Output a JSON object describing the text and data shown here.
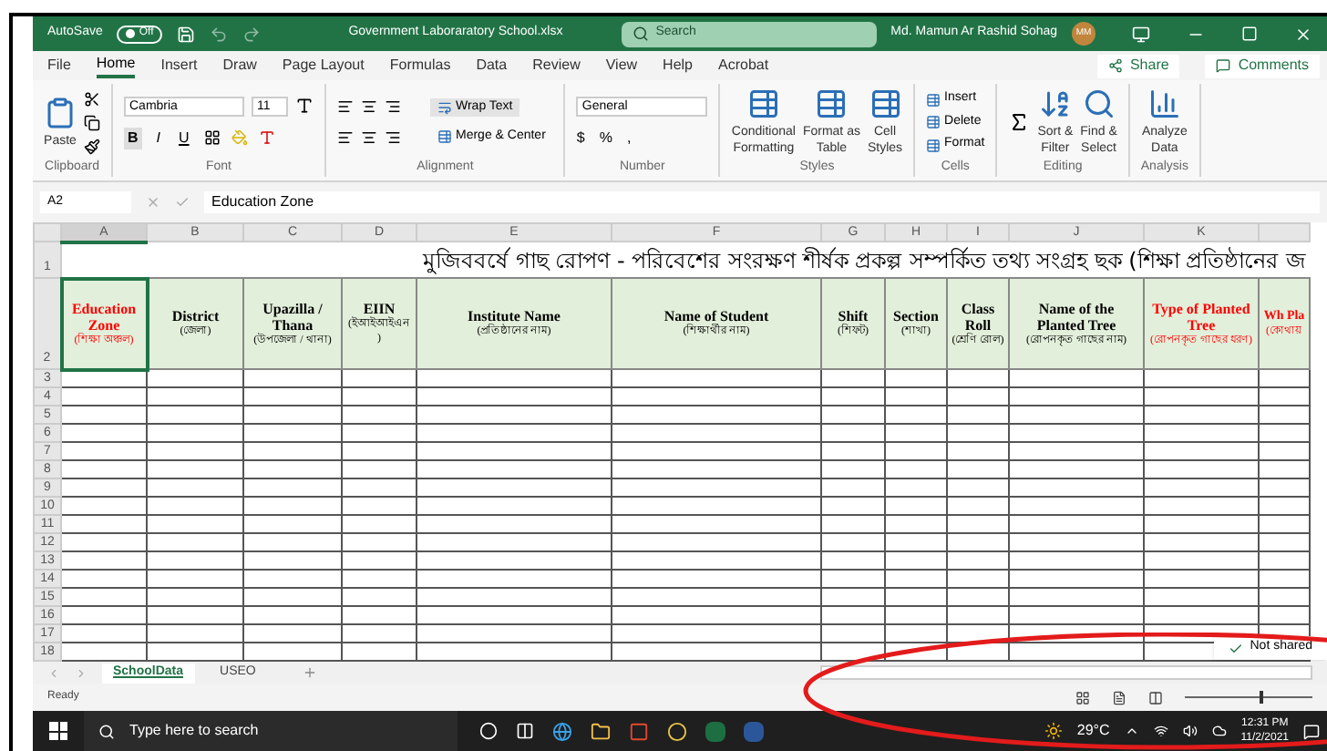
{
  "title_bar": {
    "autosave_label": "AutoSave",
    "autosave": {
      "label": "Off",
      "on": false
    },
    "filename": "Government Laboraratory School.xlsx",
    "search_placeholder": "Search",
    "user": "Md. Mamun Ar Rashid Sohag",
    "avatar": "MM"
  },
  "ribbon_tabs": [
    {
      "label": "File",
      "selected": false
    },
    {
      "label": "Home",
      "selected": true
    },
    {
      "label": "Insert",
      "selected": false
    },
    {
      "label": "Draw",
      "selected": false
    },
    {
      "label": "Page Layout",
      "selected": false
    },
    {
      "label": "Formulas",
      "selected": false
    },
    {
      "label": "Data",
      "selected": false
    },
    {
      "label": "Review",
      "selected": false
    },
    {
      "label": "View",
      "selected": false
    },
    {
      "label": "Help",
      "selected": false
    },
    {
      "label": "Acrobat",
      "selected": false
    }
  ],
  "share": "Share",
  "comments": "Comments",
  "ribbon": {
    "clipboard": {
      "paste": "Paste",
      "label": "Clipboard"
    },
    "font": {
      "name": "Cambria",
      "size": "11",
      "styles": [
        "B",
        "I",
        "U"
      ],
      "label": "Font"
    },
    "alignment": {
      "wrap": "Wrap Text",
      "merge": "Merge & Center",
      "label": "Alignment"
    },
    "number": {
      "format": "General",
      "buttons": [
        "$",
        "%",
        ","
      ],
      "label": "Number"
    },
    "styles": {
      "buttons": [
        [
          "Conditional",
          "Formatting"
        ],
        [
          "Format as",
          "Table"
        ],
        [
          "Cell",
          "Styles"
        ]
      ],
      "label": "Styles"
    },
    "cells": {
      "buttons": [
        "Insert",
        "Delete",
        "Format"
      ],
      "label": "Cells"
    },
    "editing": {
      "buttons": [
        [
          "Sort &",
          "Filter"
        ],
        [
          "Find &",
          "Select"
        ]
      ],
      "label": "Editing"
    },
    "analysis": {
      "button": [
        "Analyze",
        "Data"
      ],
      "label": "Analysis"
    }
  },
  "formula_bar": {
    "name_box": "A2",
    "value": "Education Zone"
  },
  "sheet": {
    "column_letters": [
      "A",
      "B",
      "C",
      "D",
      "E",
      "F",
      "G",
      "H",
      "I",
      "J",
      "K"
    ],
    "title": "মুজিববর্ষে গাছ রোপণ - পরিবেশের সংরক্ষণ শীর্ষক প্রকল্প সম্পর্কিত তথ্য সংগ্রহ ছক (শিক্ষা প্রতিষ্ঠানের জ",
    "headers": [
      {
        "title": "Education Zone",
        "subtitle": "(শিক্ষা অঞ্চল)",
        "color": "#ff0000",
        "selected": true
      },
      {
        "title": "District",
        "subtitle": "(জেলা)",
        "color": "#000000",
        "selected": false
      },
      {
        "title": "Upazilla / Thana",
        "subtitle": "(উপজেলা / থানা)",
        "color": "#000000",
        "selected": false
      },
      {
        "title": "EIIN",
        "subtitle": "(ইআইআইএন )",
        "color": "#000000",
        "selected": false
      },
      {
        "title": "Institute Name",
        "subtitle": "(প্রতিষ্ঠানের নাম)",
        "color": "#000000",
        "selected": false
      },
      {
        "title": "Name of Student",
        "subtitle": "(শিক্ষার্থীর নাম)",
        "color": "#000000",
        "selected": false
      },
      {
        "title": "Shift",
        "subtitle": "(শিফট)",
        "color": "#000000",
        "selected": false
      },
      {
        "title": "Section",
        "subtitle": "(শাখা)",
        "color": "#000000",
        "selected": false
      },
      {
        "title": "Class Roll",
        "subtitle": "(শ্রেণি রোল)",
        "color": "#000000",
        "selected": false
      },
      {
        "title": "Name of the Planted Tree",
        "subtitle": "(রোপনকৃত গাছের নাম)",
        "color": "#000000",
        "selected": false
      },
      {
        "title": "Type of Planted Tree",
        "subtitle": "(রোপনকৃত গাছের ধরণ)",
        "color": "#ff0000",
        "selected": false
      },
      {
        "title": "Wh Pla",
        "subtitle": "(কোথায়",
        "color": "#ff0000",
        "selected": false
      }
    ],
    "row_numbers": [
      "1",
      "2",
      "3",
      "4",
      "5",
      "6",
      "7",
      "8",
      "9",
      "10",
      "11",
      "12",
      "13",
      "14",
      "15",
      "16",
      "17",
      "18"
    ]
  },
  "sheet_tabs": [
    {
      "label": "SchoolData",
      "selected": true
    },
    {
      "label": "USEO",
      "selected": false
    }
  ],
  "toast": "Not shared",
  "status": "Ready",
  "zoom": {
    "level": 0.6
  },
  "taskbar": {
    "search_placeholder": "Type here to search",
    "temperature": "29°C",
    "time": "12:31 PM",
    "date": "11/2/2021"
  }
}
